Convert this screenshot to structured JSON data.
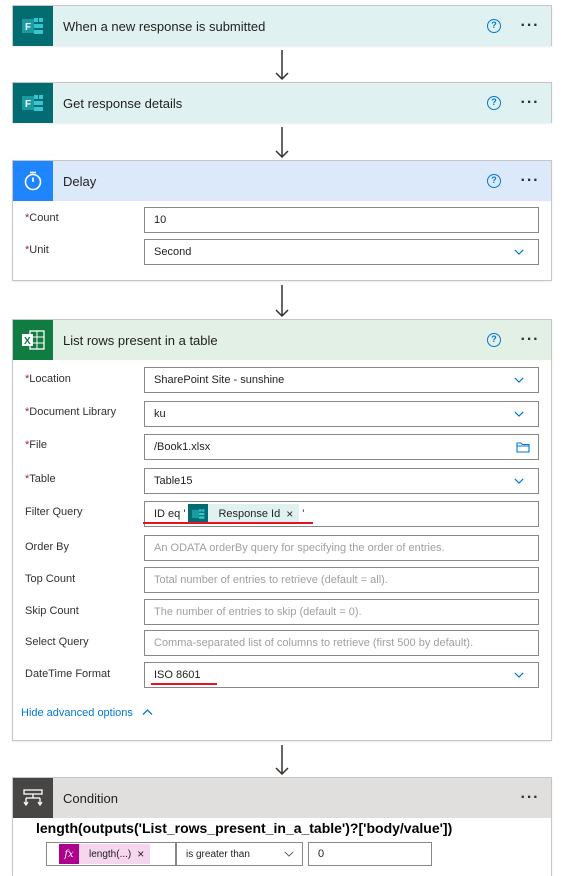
{
  "cards": {
    "trigger": {
      "title": "When a new response is submitted"
    },
    "details": {
      "title": "Get response details"
    },
    "delay": {
      "title": "Delay",
      "count_label": "Count",
      "count_value": "10",
      "unit_label": "Unit",
      "unit_value": "Second"
    },
    "list_rows": {
      "title": "List rows present in a table",
      "location_label": "Location",
      "location_value": "SharePoint Site - sunshine",
      "doclib_label": "Document Library",
      "doclib_value": "ku",
      "file_label": "File",
      "file_value": "/Book1.xlsx",
      "table_label": "Table",
      "table_value": "Table15",
      "filter_label": "Filter Query",
      "filter_prefix": "ID eq '",
      "filter_token": "Response Id",
      "filter_suffix": "'",
      "orderby_label": "Order By",
      "orderby_placeholder": "An ODATA orderBy query for specifying the order of entries.",
      "top_label": "Top Count",
      "top_placeholder": "Total number of entries to retrieve (default = all).",
      "skip_label": "Skip Count",
      "skip_placeholder": "The number of entries to skip (default = 0).",
      "select_label": "Select Query",
      "select_placeholder": "Comma-separated list of columns to retrieve (first 500 by default).",
      "datetime_label": "DateTime Format",
      "datetime_value": "ISO 8601",
      "hide_advanced": "Hide advanced options"
    },
    "condition": {
      "title": "Condition",
      "expression": "length(outputs('List_rows_present_in_a_table')?['body/value'])",
      "token_label": "length(...)",
      "operator": "is greater than",
      "value": "0"
    }
  },
  "colors": {
    "forms_header": "#dff1f1",
    "delay_header": "#dce9fb",
    "excel_header": "#e3f0e6",
    "condition_header": "#e1dfdd",
    "accent": "#0078d4",
    "required": "#a4262c",
    "highlight_line": "#e81123"
  }
}
